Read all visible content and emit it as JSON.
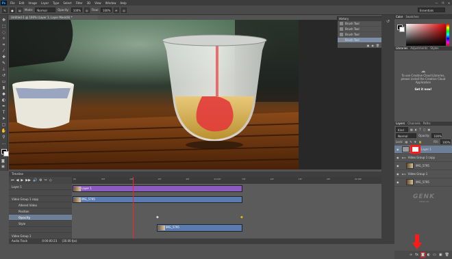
{
  "app": {
    "logo": "Ps"
  },
  "menu": [
    "File",
    "Edit",
    "Image",
    "Layer",
    "Type",
    "Select",
    "Filter",
    "3D",
    "View",
    "Window",
    "Help"
  ],
  "window_controls": [
    "—",
    "❐",
    "✕"
  ],
  "options": {
    "mode_label": "Mode:",
    "mode_value": "Normal",
    "opacity_label": "Opacity:",
    "opacity_value": "100%",
    "flow_label": "Flow:",
    "flow_value": "100%",
    "workspace": "Essentials"
  },
  "document": {
    "tab_title": "Untitled-1 @ 100% (Layer 1, Layer Mask/8) *"
  },
  "history": {
    "title": "History",
    "items": [
      "Brush Tool",
      "Brush Tool",
      "Brush Tool",
      "Brush Tool"
    ]
  },
  "color_panel": {
    "tabs": [
      "Color",
      "Swatches"
    ]
  },
  "libraries": {
    "tabs": [
      "Libraries",
      "Adjustments",
      "Styles"
    ],
    "message": [
      "To use Creative Cloud Libraries,",
      "please install the Creative Cloud",
      "Application"
    ],
    "link": "Get it now!"
  },
  "layers": {
    "tabs": [
      "Layers",
      "Channels",
      "Paths"
    ],
    "kind_label": "Kind",
    "blend_mode": "Normal",
    "opacity_label": "Opacity:",
    "opacity_value": "100%",
    "lock_label": "Lock:",
    "fill_label": "Fill:",
    "fill_value": "100%",
    "rows": [
      {
        "name": "Layer 1"
      },
      {
        "name": "Video Group 1 copy"
      },
      {
        "name": "IMG_5795"
      },
      {
        "name": "Video Group 1"
      },
      {
        "name": "IMG_5795"
      }
    ],
    "watermark": "GENK",
    "watermark_sub": "GENK.VN"
  },
  "timeline": {
    "title": "Timeline",
    "tracks": [
      "Layer 1",
      "",
      "Video Group 1 copy",
      "Altered Video",
      "Position",
      "Opacity",
      "Style",
      "",
      "Video Group 1",
      ""
    ],
    "footer_label": "Audio Track",
    "timecode": "0:00:00:23",
    "fps": "(30.00 fps)",
    "clips": [
      {
        "label": "Layer 1"
      },
      {
        "label": "IMG_5795"
      },
      {
        "label": "IMG_5795"
      }
    ],
    "ruler_marks": [
      "00",
      "05f",
      "10f",
      "15f",
      "20f",
      "01:00f",
      "05f",
      "10f",
      "15f",
      "20f",
      "02:00f"
    ]
  },
  "colors": {
    "accent_red": "#ff1a1a",
    "clip_purple": "#8a5cc0",
    "clip_blue": "#5a7bb0"
  }
}
